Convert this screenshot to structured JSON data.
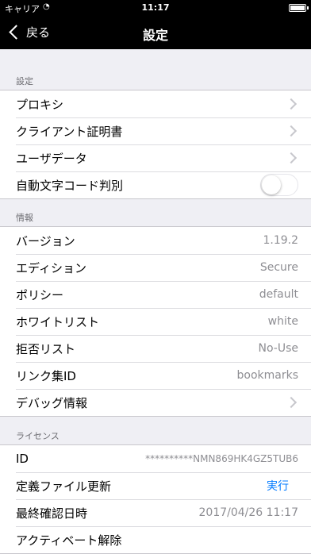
{
  "status_bar": {
    "carrier": "キャリア",
    "time": "11:17",
    "wifi_icon": "wifi-icon",
    "battery_icon": "battery-icon"
  },
  "nav": {
    "back_label": "戻る",
    "title": "設定"
  },
  "sections": {
    "settings": {
      "header": "設定",
      "rows": [
        {
          "label": "プロキシ"
        },
        {
          "label": "クライアント証明書"
        },
        {
          "label": "ユーザデータ"
        },
        {
          "label": "自動文字コード判別",
          "toggle": false
        }
      ]
    },
    "info": {
      "header": "情報",
      "rows": [
        {
          "label": "バージョン",
          "value": "1.19.2"
        },
        {
          "label": "エディション",
          "value": "Secure"
        },
        {
          "label": "ポリシー",
          "value": "default"
        },
        {
          "label": "ホワイトリスト",
          "value": "white"
        },
        {
          "label": "拒否リスト",
          "value": "No-Use"
        },
        {
          "label": "リンク集ID",
          "value": "bookmarks"
        },
        {
          "label": "デバッグ情報"
        }
      ]
    },
    "license": {
      "header": "ライセンス",
      "rows": [
        {
          "label": "ID",
          "value": "**********NMN869HK4GZ5TUB6"
        },
        {
          "label": "定義ファイル更新",
          "action": "実行"
        },
        {
          "label": "最終確認日時",
          "value": "2017/04/26 11:17"
        },
        {
          "label": "アクティベート解除"
        }
      ]
    }
  },
  "colors": {
    "background": "#efeff4",
    "accent": "#007aff",
    "bar": "#000000"
  }
}
